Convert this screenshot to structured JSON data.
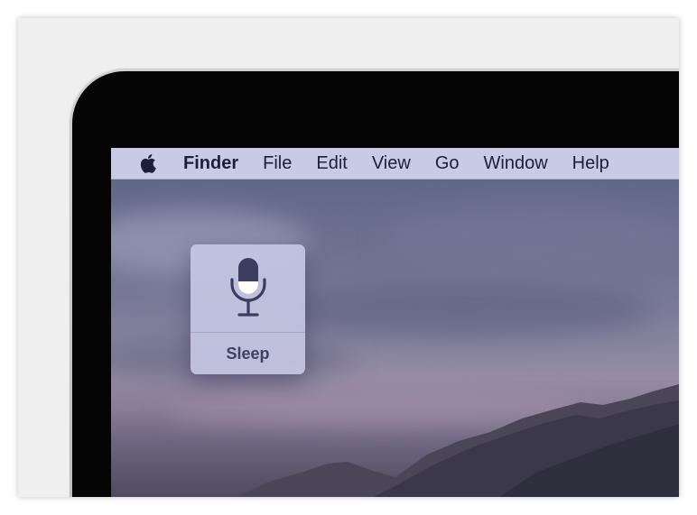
{
  "menubar": {
    "apple_menu_icon": "apple-logo-icon",
    "items": [
      {
        "label": "Finder",
        "bold": true
      },
      {
        "label": "File"
      },
      {
        "label": "Edit"
      },
      {
        "label": "View"
      },
      {
        "label": "Go"
      },
      {
        "label": "Window"
      },
      {
        "label": "Help"
      }
    ]
  },
  "dictation_hud": {
    "icon": "microphone-icon",
    "status_label": "Sleep"
  },
  "colors": {
    "menubar_background": "#c9cae6",
    "menubar_text": "#1d1f3a",
    "hud_background": "#c8cae6",
    "hud_icon": "#3b3d5e",
    "hud_label": "#3e4160",
    "bezel": "#050506"
  }
}
